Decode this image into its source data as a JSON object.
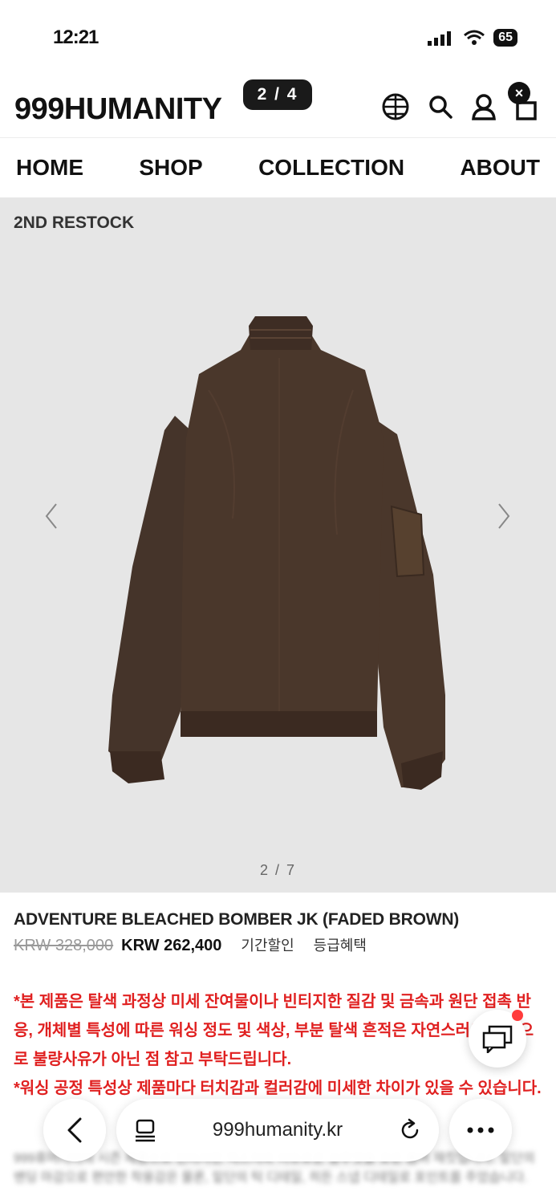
{
  "status": {
    "time": "12:21",
    "battery": "65"
  },
  "header": {
    "logo": "999HUMANITY",
    "image_counter_pill": "2 / 4",
    "close_symbol": "×"
  },
  "nav": {
    "items": [
      "HOME",
      "SHOP",
      "COLLECTION",
      "ABOUT"
    ]
  },
  "gallery": {
    "tag": "2ND RESTOCK",
    "counter": "2 / 7"
  },
  "product": {
    "title": "ADVENTURE BLEACHED BOMBER JK (FADED BROWN)",
    "original_price": "KRW 328,000",
    "sale_price": "KRW 262,400",
    "link_period_discount": "기간할인",
    "link_tier_benefit": "등급혜택",
    "notice_1": "*본 제품은 탈색 과정상 미세 잔여물이나 빈티지한 질감 및 금속과 원단 접촉 반응, 개체별 특성에 따른 워싱 정도 및 색상, 부분 탈색 흔적은 자연스러운 현상으로 불량사유가 아닌 점 참고 부탁드립니다.",
    "notice_2": "*워싱 공정 특성상 제품마다 터치감과 컬러감에 미세한 차이가 있을 수 있습니다.",
    "blurred_desc": "999휴머니티의 시즌 제품으로 빈티지한 텍스처와 여유로운 실루엣을 갖춘 봄버 재킷입니다. 밑단의 밴딩 마감으로 편안한 착용감은 물론, 밑단의 턱 디테일, 히든 스냅 디테일로 포인트를 주었습니다."
  },
  "browser": {
    "url": "999humanity.kr"
  },
  "colors": {
    "notice_red": "#e02020",
    "gallery_bg": "#e6e6e6",
    "jacket_brown": "#4a372b"
  }
}
